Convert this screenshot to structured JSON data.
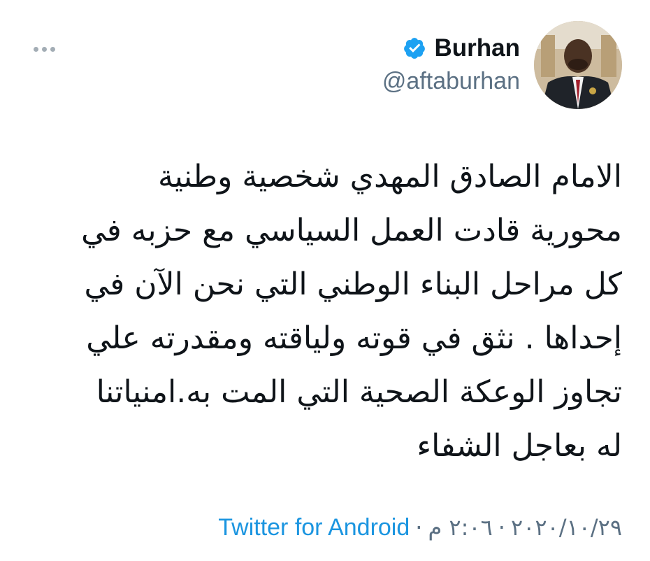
{
  "author": {
    "display_name": "Burhan",
    "handle": "@aftaburhan",
    "verified": true,
    "avatar_icon": "profile-photo",
    "verified_icon": "verified-badge-icon",
    "verified_color": "#1da1f2"
  },
  "header": {
    "more_icon": "more-options-icon"
  },
  "tweet": {
    "lines": [
      "الامام الصادق المهدي شخصية وطنية",
      "محورية قادت العمل السياسي مع حزبه في",
      "كل مراحل البناء الوطني التي نحن الآن في",
      "إحداها . نثق في قوته ولياقته ومقدرته علي",
      "تجاوز الوعكة الصحية التي المت به.امنياتنا",
      "له بعاجل الشفاء"
    ]
  },
  "meta": {
    "date": "٢٠٢٠/١٠/٢٩",
    "separator": "·",
    "time": "٢:٠٦ م",
    "source": "Twitter for Android"
  },
  "colors": {
    "text": "#0f1419",
    "secondary": "#5b7083",
    "link": "#1b95e0"
  }
}
